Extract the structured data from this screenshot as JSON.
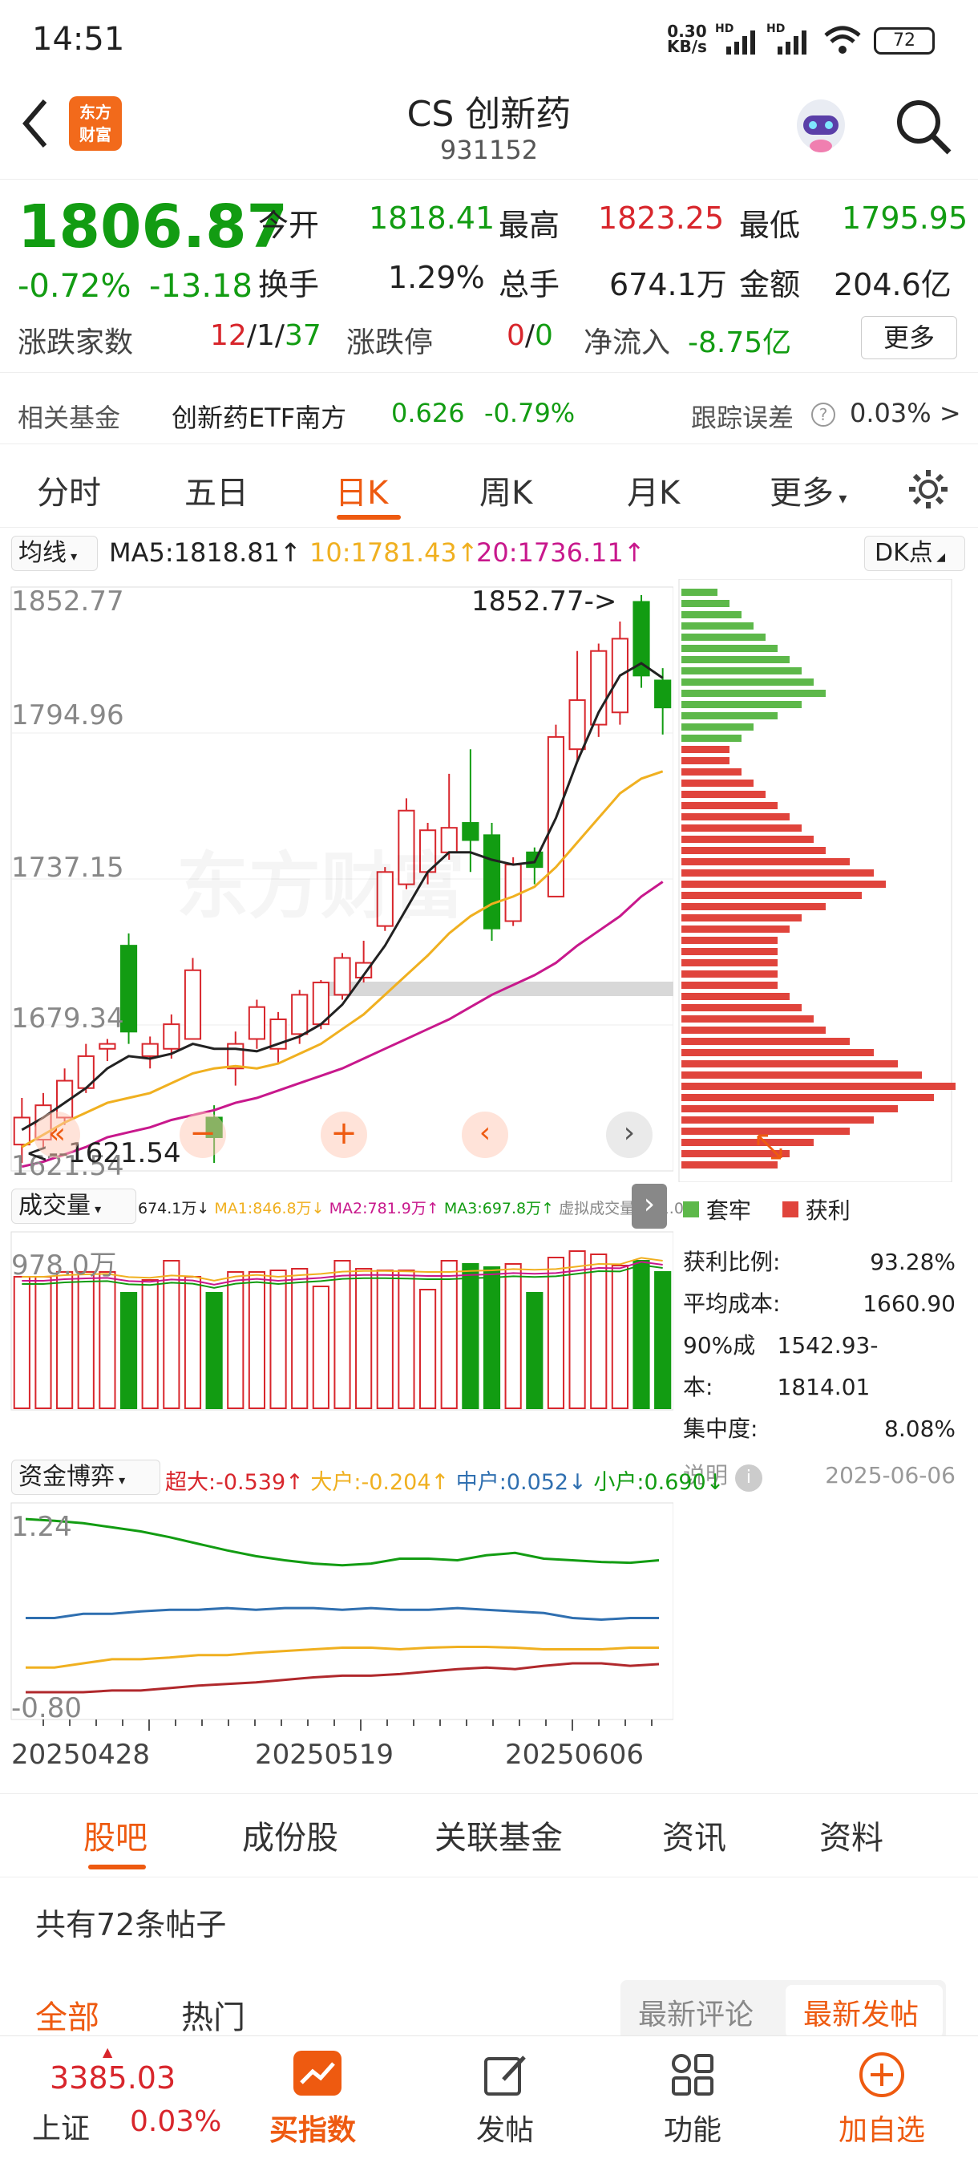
{
  "status_bar": {
    "time": "14:51",
    "net_speed": "0.30",
    "net_unit": "KB/s",
    "signal1": "HD",
    "signal2": "HD",
    "battery": "72"
  },
  "header": {
    "logo_line1": "东方",
    "logo_line2": "财富",
    "title": "CS 创新药",
    "code": "931152"
  },
  "quote": {
    "price": "1806.87",
    "change_pct": "-0.72%",
    "change": "-13.18",
    "open_label": "今开",
    "open": "1818.41",
    "high_label": "最高",
    "high": "1823.25",
    "low_label": "最低",
    "low": "1795.95",
    "turnover_label": "换手",
    "turnover": "1.29%",
    "volume_label": "总手",
    "volume": "674.1万",
    "amount_label": "金额",
    "amount": "204.6亿",
    "breadth_label": "涨跌家数",
    "breadth_up": "12",
    "breadth_sep1": "/",
    "breadth_flat": "1",
    "breadth_sep2": "/",
    "breadth_down": "37",
    "limit_label": "涨跌停",
    "limit_up": "0",
    "limit_sep": "/",
    "limit_down": "0",
    "inflow_label": "净流入",
    "inflow": "-8.75亿",
    "more_button": "更多",
    "fund_label": "相关基金",
    "fund_name": "创新药ETF南方",
    "fund_price": "0.626",
    "fund_change": "-0.79%",
    "tracking_label": "跟踪误差",
    "tracking_value": "0.03%",
    "tracking_arrow": ">"
  },
  "tabs": [
    "分时",
    "五日",
    "日K",
    "周K",
    "月K",
    "更多"
  ],
  "ma": {
    "selector": "均线",
    "ma5": "MA5:1818.81",
    "ma10": "10:1781.43",
    "ma20": "20:1736.11",
    "dk_button": "DK点",
    "colors": {
      "ma5": "#222222",
      "ma10": "#f0b020",
      "ma20": "#c8188c"
    }
  },
  "kline": {
    "y_labels": [
      "1852.77",
      "1794.96",
      "1737.15",
      "1679.34",
      "1621.54"
    ],
    "max_annot": "1852.77->",
    "min_annot": "<--1621.54",
    "watermark": "东方财富",
    "up_color": "#d8262c",
    "down_color": "#129c12"
  },
  "chip": {
    "legend_trapped": "套牢",
    "legend_profit": "获利",
    "rows": [
      [
        "获利比例:",
        "93.28%"
      ],
      [
        "平均成本:",
        "1660.90"
      ],
      [
        "90%成本:",
        "1542.93-1814.01"
      ],
      [
        "集中度:",
        "8.08%"
      ]
    ],
    "note_label": "说明",
    "date": "2025-06-06"
  },
  "volume": {
    "selector": "成交量",
    "v": "674.1万",
    "ma1": "MA1:846.8万",
    "ma2": "MA2:781.9万",
    "ma3": "MA3:697.8万",
    "virtual": "虚拟成交量:701.0万",
    "y_label": "978.0万"
  },
  "capital": {
    "selector": "资金博弈",
    "super": "超大:-0.539",
    "big": "大户:-0.204",
    "mid": "中户:0.052",
    "small": "小户:0.690",
    "y_top": "1.24",
    "y_bottom": "-0.80"
  },
  "dates": [
    "20250428",
    "20250519",
    "20250606"
  ],
  "chart_data": {
    "type": "candlestick",
    "x": [
      "20250428",
      "20250519",
      "20250606"
    ],
    "ylim": [
      1621.54,
      1852.77
    ],
    "candles": [
      [
        1629,
        1640,
        1621.54,
        1648
      ],
      [
        1631,
        1645,
        1627,
        1650
      ],
      [
        1640,
        1655,
        1637,
        1660
      ],
      [
        1652,
        1665,
        1650,
        1670
      ],
      [
        1668,
        1670,
        1663,
        1672
      ],
      [
        1710,
        1675,
        1670,
        1715
      ],
      [
        1665,
        1670,
        1660,
        1673
      ],
      [
        1668,
        1678,
        1664,
        1682
      ],
      [
        1672,
        1700,
        1672,
        1705
      ],
      [
        1640,
        1632,
        1621.54,
        1645
      ],
      [
        1660,
        1670,
        1653,
        1675
      ],
      [
        1672,
        1685,
        1668,
        1688
      ],
      [
        1668,
        1680,
        1662,
        1683
      ],
      [
        1674,
        1690,
        1670,
        1692
      ],
      [
        1678,
        1695,
        1676,
        1696
      ],
      [
        1690,
        1705,
        1688,
        1707
      ],
      [
        1697,
        1703,
        1695,
        1712
      ],
      [
        1718,
        1740,
        1716,
        1742
      ],
      [
        1735,
        1765,
        1733,
        1770
      ],
      [
        1740,
        1757,
        1735,
        1760
      ],
      [
        1748,
        1758,
        1745,
        1780
      ],
      [
        1760,
        1753,
        1740,
        1790
      ],
      [
        1755,
        1717,
        1712,
        1760
      ],
      [
        1720,
        1743,
        1718,
        1746
      ],
      [
        1748,
        1742,
        1735,
        1750
      ],
      [
        1730,
        1795,
        1730,
        1800
      ],
      [
        1790,
        1810,
        1785,
        1830
      ],
      [
        1800,
        1830,
        1795,
        1833
      ],
      [
        1805,
        1835,
        1800,
        1842
      ],
      [
        1850,
        1820,
        1815,
        1852.77
      ],
      [
        1818,
        1807,
        1796,
        1823
      ]
    ],
    "ma5": [
      1635,
      1640,
      1646,
      1652,
      1660,
      1665,
      1664,
      1666,
      1670,
      1668,
      1668,
      1667,
      1670,
      1673,
      1678,
      1686,
      1698,
      1710,
      1725,
      1740,
      1748,
      1748,
      1745,
      1743,
      1744,
      1762,
      1785,
      1805,
      1820,
      1825,
      1819
    ],
    "ma10": [
      1628,
      1633,
      1638,
      1642,
      1646,
      1648,
      1650,
      1654,
      1658,
      1660,
      1661,
      1660,
      1662,
      1666,
      1670,
      1676,
      1682,
      1690,
      1698,
      1706,
      1715,
      1722,
      1727,
      1730,
      1734,
      1742,
      1752,
      1762,
      1772,
      1778,
      1781
    ],
    "ma20": [
      1620,
      1622,
      1625,
      1628,
      1632,
      1634,
      1636,
      1639,
      1641,
      1643,
      1646,
      1648,
      1651,
      1654,
      1657,
      1660,
      1664,
      1668,
      1672,
      1676,
      1680,
      1685,
      1690,
      1694,
      1698,
      1703,
      1710,
      1716,
      1722,
      1730,
      1736
    ],
    "volumes": [
      820,
      820,
      850,
      850,
      850,
      720,
      800,
      920,
      820,
      720,
      850,
      850,
      860,
      870,
      760,
      920,
      870,
      860,
      860,
      740,
      920,
      900,
      880,
      900,
      720,
      940,
      980,
      960,
      890,
      920,
      850
    ],
    "chip_dist": [
      0.15,
      0.2,
      0.25,
      0.3,
      0.35,
      0.4,
      0.45,
      0.5,
      0.55,
      0.6,
      0.5,
      0.4,
      0.3,
      0.25,
      0.2,
      0.2,
      0.25,
      0.3,
      0.35,
      0.4,
      0.45,
      0.5,
      0.55,
      0.6,
      0.7,
      0.8,
      0.85,
      0.75,
      0.6,
      0.5,
      0.45,
      0.4,
      0.4,
      0.4,
      0.4,
      0.4,
      0.45,
      0.5,
      0.55,
      0.6,
      0.7,
      0.8,
      0.9,
      1.0,
      1.15,
      1.05,
      0.9,
      0.8,
      0.7,
      0.55,
      0.45,
      0.4
    ],
    "capital": {
      "super": [
        1.2,
        1.18,
        1.15,
        1.1,
        1.05,
        0.98,
        0.9,
        0.82,
        0.75,
        0.7,
        0.66,
        0.64,
        0.66,
        0.72,
        0.72,
        0.7,
        0.76,
        0.79,
        0.72,
        0.7,
        0.68,
        0.67,
        0.7
      ],
      "big": [
        -0.6,
        -0.6,
        -0.55,
        -0.5,
        -0.5,
        -0.48,
        -0.45,
        -0.45,
        -0.42,
        -0.4,
        -0.38,
        -0.36,
        -0.36,
        -0.38,
        -0.36,
        -0.35,
        -0.35,
        -0.36,
        -0.38,
        -0.38,
        -0.38,
        -0.36,
        -0.36
      ],
      "mid": [
        0.0,
        0.0,
        0.05,
        0.05,
        0.08,
        0.1,
        0.1,
        0.12,
        0.1,
        0.12,
        0.12,
        0.1,
        0.12,
        0.1,
        0.1,
        0.12,
        0.1,
        0.08,
        0.06,
        0.0,
        -0.02,
        0.0,
        0.0
      ],
      "small": [
        -0.9,
        -0.9,
        -0.9,
        -0.88,
        -0.88,
        -0.85,
        -0.82,
        -0.8,
        -0.78,
        -0.75,
        -0.72,
        -0.7,
        -0.7,
        -0.68,
        -0.65,
        -0.62,
        -0.6,
        -0.62,
        -0.58,
        -0.55,
        -0.55,
        -0.58,
        -0.56
      ]
    }
  },
  "bottom_tabs": [
    "股吧",
    "成份股",
    "关联基金",
    "资讯",
    "资料"
  ],
  "posts": {
    "count_text": "共有72条帖子",
    "filter_all": "全部",
    "filter_hot": "热门",
    "sort_comment": "最新评论",
    "sort_post": "最新发帖"
  },
  "bottom_nav": {
    "index_value": "3385.03",
    "index_name": "上证",
    "index_change": "0.03%",
    "buy": "买指数",
    "post": "发帖",
    "func": "功能",
    "add": "加自选"
  }
}
